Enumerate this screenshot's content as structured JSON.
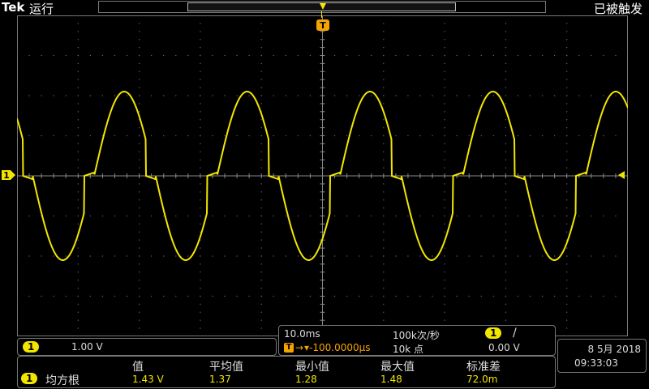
{
  "header": {
    "brand": "Tek",
    "run_state": "运行",
    "trigger_state": "已被触发"
  },
  "channel": {
    "label": "1",
    "color": "#f2e600",
    "volts_per_div": "1.00 V"
  },
  "timebase": {
    "sec_per_div": "10.0ms",
    "sample_rate": "100k次/秒",
    "record_length": "10k 点",
    "trigger_position": "▾-100.0000µs"
  },
  "trigger": {
    "source": "1",
    "slope_icon": "/",
    "level": "0.00 V",
    "marker": "T",
    "position_arrow": "→"
  },
  "datetime": {
    "date": "8 5月 2018",
    "time": "09:33:03"
  },
  "measurements": {
    "headers": [
      "值",
      "平均值",
      "最小值",
      "最大值",
      "标准差"
    ],
    "rows": [
      {
        "source": "1",
        "name": "均方根",
        "value": "1.43 V",
        "mean": "1.37",
        "min": "1.28",
        "max": "1.48",
        "stdev": "72.0m"
      }
    ]
  }
}
